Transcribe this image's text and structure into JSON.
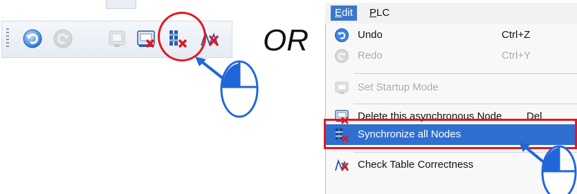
{
  "toolbar": {
    "buttons": [
      {
        "name": "undo",
        "icon": "undo-icon",
        "enabled": true
      },
      {
        "name": "redo",
        "icon": "redo-icon",
        "enabled": false
      },
      {
        "name": "set-startup-mode",
        "icon": "startup-mode-icon",
        "enabled": false
      },
      {
        "name": "delete-async-node",
        "icon": "delete-node-icon",
        "enabled": true
      },
      {
        "name": "synchronize-all-nodes",
        "icon": "synchronize-nodes-icon",
        "enabled": true
      },
      {
        "name": "check-table",
        "icon": "check-table-icon",
        "enabled": true
      }
    ]
  },
  "separator_text": "OR",
  "menubar": {
    "items": [
      {
        "label": "Edit",
        "mnemonic": "E",
        "rest": "dit",
        "active": true
      },
      {
        "label": "PLC",
        "mnemonic": "P",
        "rest": "LC",
        "active": false
      }
    ]
  },
  "menu": {
    "items": [
      {
        "label": "Undo",
        "shortcut": "Ctrl+Z",
        "icon": "undo-icon",
        "enabled": true
      },
      {
        "label": "Redo",
        "shortcut": "Ctrl+Y",
        "icon": "redo-icon",
        "enabled": false
      },
      {
        "label": "Set Startup Mode",
        "shortcut": "",
        "icon": "startup-mode-icon",
        "enabled": false
      },
      {
        "label": "Delete this asynchronous Node",
        "shortcut": "Del",
        "icon": "delete-node-icon",
        "enabled": true
      },
      {
        "label": "Synchronize all Nodes",
        "shortcut": "",
        "icon": "synchronize-nodes-icon",
        "enabled": true,
        "highlighted": true
      },
      {
        "label": "Check Table Correctness",
        "shortcut": "",
        "icon": "check-table-icon",
        "enabled": true
      }
    ]
  },
  "colors": {
    "highlight": "#2f6fd0",
    "callout_red": "#e8141c",
    "arrow_blue": "#1f66d9"
  }
}
